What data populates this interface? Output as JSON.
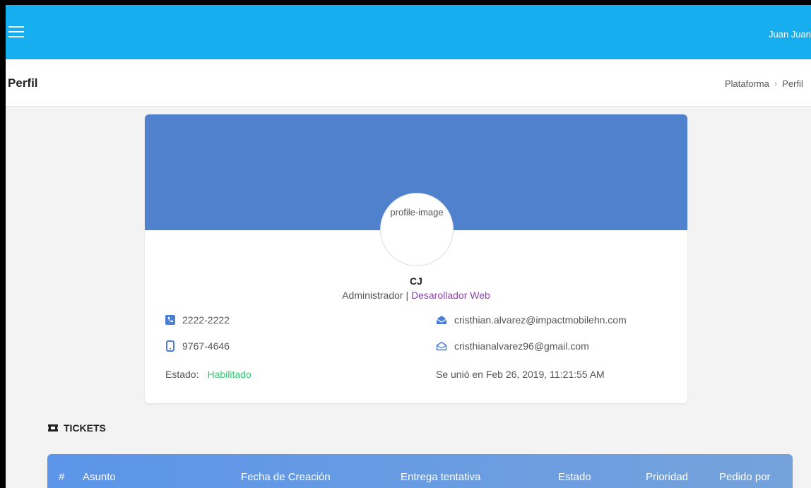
{
  "header": {
    "user": "Juan  Juan"
  },
  "page": {
    "title": "Perfil",
    "breadcrumb": [
      "Plataforma",
      "Perfil"
    ]
  },
  "profile": {
    "avatar_alt": "profile-image",
    "name": "CJ",
    "role": "Administrador",
    "role_separator": "|",
    "job_title": "Desarollador Web",
    "phone": "2222-2222",
    "mobile": "9767-4646",
    "status_label": "Estado:",
    "status_value": "Habilitado",
    "work_email": "cristhian.alvarez@impactmobilehn.com",
    "personal_email": "cristhianalvarez96@gmail.com",
    "joined": "Se unió en Feb 26, 2019, 11:21:55 AM"
  },
  "tickets": {
    "title": "TICKETS",
    "columns": [
      "#",
      "Asunto",
      "Fecha de Creación",
      "Entrega tentativa",
      "Estado",
      "Prioridad",
      "Pedido por"
    ]
  },
  "colors": {
    "topbar": "#17aef0",
    "banner": "#5081cd",
    "status": "#2ecc71",
    "job": "#8e44ad",
    "icon": "#4a7fd4"
  },
  "icons": [
    "hamburger-icon",
    "phone-icon",
    "mobile-icon",
    "envelope-open-icon",
    "envelope-outline-icon",
    "ticket-icon",
    "chevron-right-icon"
  ]
}
